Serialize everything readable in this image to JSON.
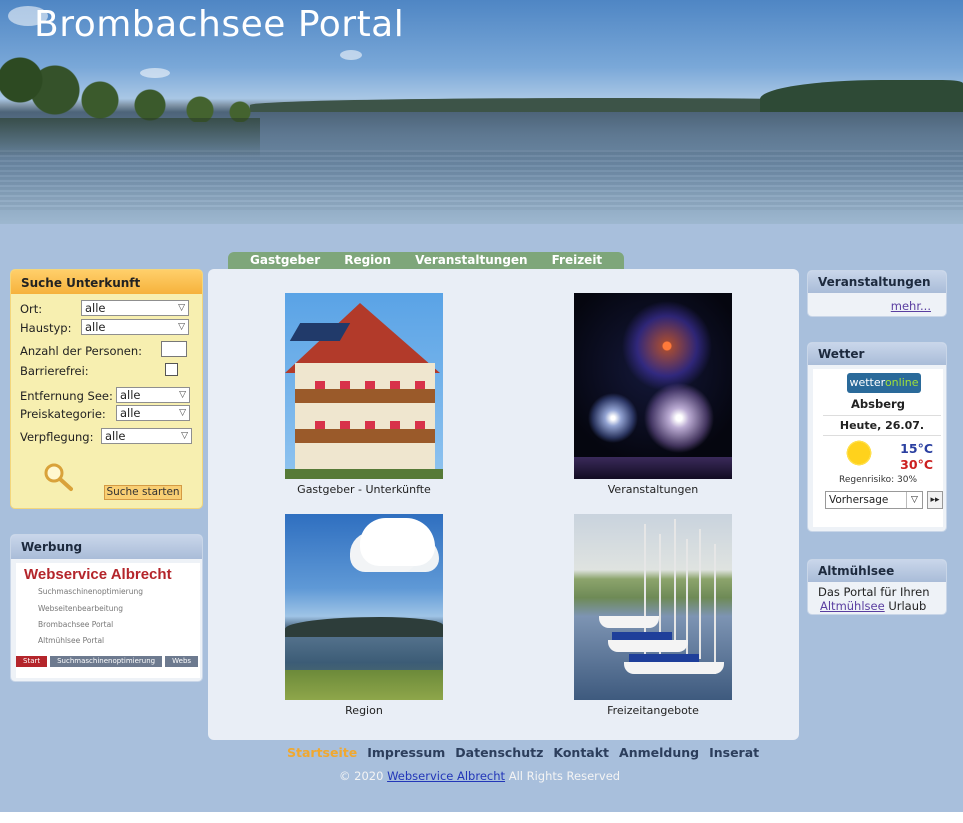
{
  "site": {
    "title": "Brombachsee Portal"
  },
  "tabs": [
    "Gastgeber",
    "Region",
    "Veranstaltungen",
    "Freizeit"
  ],
  "search": {
    "title": "Suche Unterkunft",
    "ort_label": "Ort:",
    "ort_value": "alle",
    "haustyp_label": "Haustyp:",
    "haustyp_value": "alle",
    "personen_label": "Anzahl der Personen:",
    "personen_value": "",
    "barrierefrei_label": "Barrierefrei:",
    "entfernung_label": "Entfernung See:",
    "entfernung_value": "alle",
    "preis_label": "Preiskategorie:",
    "preis_value": "alle",
    "verpflegung_label": "Verpflegung:",
    "verpflegung_value": "alle",
    "button": "Suche starten"
  },
  "ad": {
    "title": "Werbung",
    "brand": "Webservice Albrecht",
    "lines": [
      "Suchmaschinenoptimierung",
      "Webseitenbearbeitung",
      "Brombachsee Portal",
      "Altmühlsee Portal"
    ],
    "bar": [
      "Start",
      "Suchmaschinenoptimierung",
      "Webs"
    ]
  },
  "tiles": [
    {
      "caption": "Gastgeber - Unterkünfte"
    },
    {
      "caption": "Veranstaltungen"
    },
    {
      "caption": "Region"
    },
    {
      "caption": "Freizeitangebote"
    }
  ],
  "events": {
    "title": "Veranstaltungen",
    "more": "mehr..."
  },
  "weather": {
    "title": "Wetter",
    "logo_a": "wetter",
    "logo_b": "online",
    "city": "Absberg",
    "day": "Heute, 26.07.",
    "low": "15°C",
    "high": "30°C",
    "rain": "Regenrisiko: 30%",
    "select": "Vorhersage",
    "next": "▸▸",
    "icon": "sun-icon"
  },
  "altmuehl": {
    "title": "Altmühlsee",
    "line1": "Das Portal für Ihren",
    "link": "Altmühlsee",
    "line2": " Urlaub"
  },
  "footer": {
    "nav": [
      "Startseite",
      "Impressum",
      "Datenschutz",
      "Kontakt",
      "Anmeldung",
      "Inserat"
    ],
    "copy_prefix": "© 2020 ",
    "copy_link": "Webservice Albrecht",
    "copy_suffix": " All Rights Reserved"
  },
  "colors": {
    "accent": "#f0a830",
    "tabs": "#7ea67a",
    "background": "#a8bfdc"
  }
}
